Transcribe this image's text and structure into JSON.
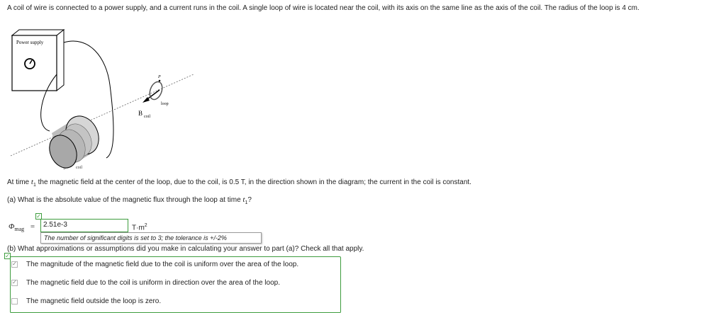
{
  "intro_text": "A coil of wire is connected to a power supply, and a current runs in the coil. A single loop of wire is located near the coil, with its axis on the same line as the axis of the coil. The radius of the loop is 4 cm.",
  "figure": {
    "power_supply_label": "Power supply",
    "p_label": "P",
    "loop_label": "loop",
    "b_label": "B",
    "b_sub": "coil",
    "coil_label": "coil"
  },
  "statement": {
    "pre": "At time ",
    "t": "t",
    "t_sub": "1",
    "post": " the magnetic field at the center of the loop, due to the coil, is 0.5 T, in the direction shown in the diagram; the current in the coil is constant."
  },
  "part_a": {
    "pre": "(a) What is the absolute value of the magnetic flux through the loop at time ",
    "t": "t",
    "t_sub": "1",
    "post": "?",
    "phi_symbol": "Φ",
    "phi_sub": "mag",
    "equals": "=",
    "answer_value": "2.51e-3",
    "unit": "T·m",
    "unit_exp": "2",
    "tooltip": "The number of significant digits is set to 3; the tolerance is +/-2%"
  },
  "part_b": {
    "question": "(b) What approximations or assumptions did you make in calculating your answer to part (a)? Check all that apply.",
    "options": [
      {
        "label": "The magnitude of the magnetic field due to the coil is uniform over the area of the loop.",
        "checked": true
      },
      {
        "label": "The magnetic field due to the coil is uniform in direction over the area of the loop.",
        "checked": true
      },
      {
        "label": "The magnetic field outside the loop is zero.",
        "checked": false
      }
    ]
  },
  "colors": {
    "correct_green": "#3d9c3d",
    "text": "#222222"
  }
}
